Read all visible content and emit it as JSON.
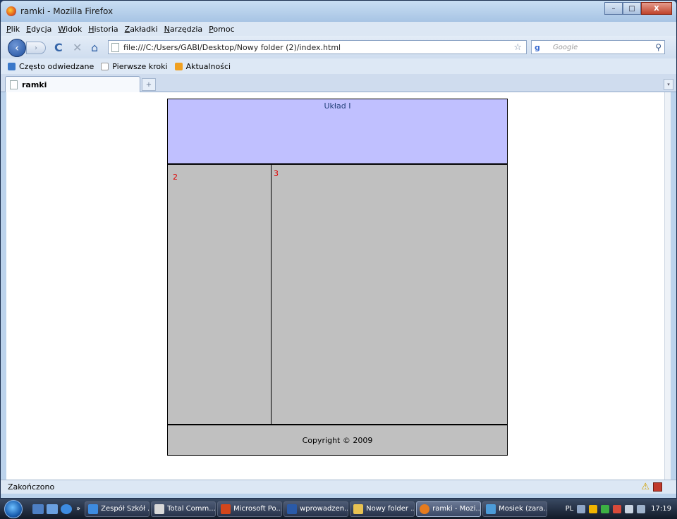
{
  "window": {
    "title": "ramki - Mozilla Firefox",
    "controls": {
      "minimize": "–",
      "maximize": "□",
      "close": "X"
    }
  },
  "menu": {
    "items": [
      "Plik",
      "Edycja",
      "Widok",
      "Historia",
      "Zakładki",
      "Narzędzia",
      "Pomoc"
    ]
  },
  "nav": {
    "back": "‹",
    "forward": "›",
    "reload": "C",
    "stop": "✕",
    "home": "⌂",
    "url": "file:///C:/Users/GABI/Desktop/Nowy folder (2)/index.html",
    "bookmark_star": "☆",
    "search_placeholder": "Google",
    "search_engine": "g",
    "search_icon": "⚲"
  },
  "bookmarks": {
    "items": [
      {
        "label": "Często odwiedzane",
        "color": "#3a78c9"
      },
      {
        "label": "Pierwsze kroki",
        "color": "#ffffff"
      },
      {
        "label": "Aktualności",
        "color": "#f0a020"
      }
    ]
  },
  "tabs": {
    "active_label": "ramki",
    "new_tab": "+",
    "list": "▾"
  },
  "page": {
    "header_title": "Układ I",
    "left_number": "2",
    "right_number": "3",
    "footer": "Copyright © 2009",
    "colors": {
      "header": "#c0c0ff",
      "body": "#c0c0c0",
      "numbers": "#e00000"
    }
  },
  "status": {
    "text": "Zakończono",
    "warning": "⚠"
  },
  "taskbar": {
    "more": "»",
    "tasks": [
      {
        "label": "Zespół Szkół ...",
        "color": "#3d8be0"
      },
      {
        "label": "Total Comm...",
        "color": "#d9d9d9"
      },
      {
        "label": "Microsoft Po...",
        "color": "#d2461b"
      },
      {
        "label": "wprowadzen...",
        "color": "#2a5aa8"
      },
      {
        "label": "Nowy folder ...",
        "color": "#e8c252"
      },
      {
        "label": "ramki - Mozi...",
        "color": "#e57b1e"
      },
      {
        "label": "Mosiek (zara...",
        "color": "#4c9bd8"
      }
    ],
    "lang": "PL",
    "time": "17:19"
  }
}
